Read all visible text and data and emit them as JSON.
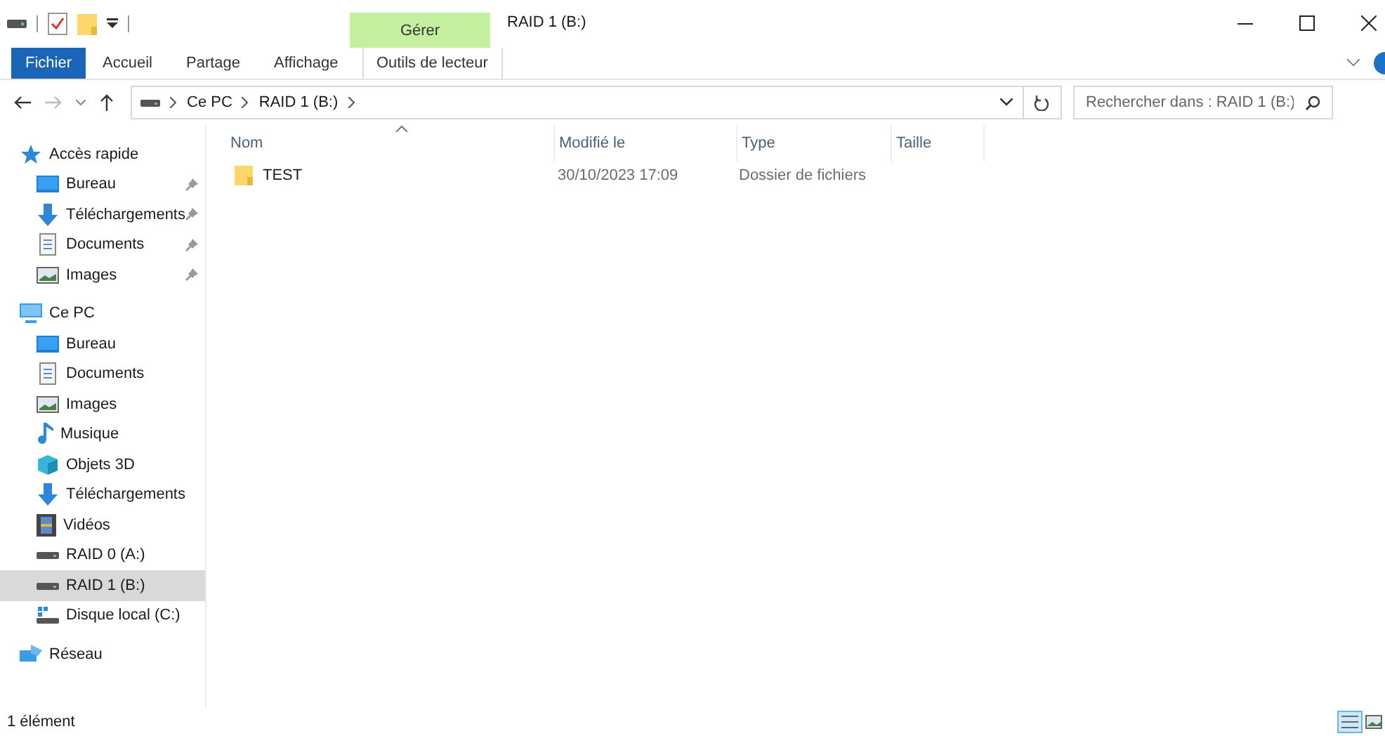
{
  "window": {
    "title": "RAID 1 (B:)",
    "context_tab": "Gérer"
  },
  "ribbon": {
    "tabs": [
      {
        "label": "Fichier",
        "kind": "file",
        "selected": false
      },
      {
        "label": "Accueil",
        "kind": "tab",
        "selected": false
      },
      {
        "label": "Partage",
        "kind": "tab",
        "selected": false
      },
      {
        "label": "Affichage",
        "kind": "tab",
        "selected": false
      },
      {
        "label": "Outils de lecteur",
        "kind": "context",
        "selected": false
      }
    ]
  },
  "address_bar": {
    "path": [
      "Ce PC",
      "RAID 1 (B:)"
    ]
  },
  "search": {
    "placeholder": "Rechercher dans : RAID 1 (B:)"
  },
  "sidebar": {
    "sections": [
      {
        "label": "Accès rapide",
        "kind": "star",
        "selected": false,
        "children": [
          {
            "label": "Bureau",
            "kind": "desktop",
            "pinned": true,
            "selected": false
          },
          {
            "label": "Téléchargements",
            "kind": "download",
            "pinned": true,
            "selected": false
          },
          {
            "label": "Documents",
            "kind": "document",
            "pinned": true,
            "selected": false
          },
          {
            "label": "Images",
            "kind": "image",
            "pinned": true,
            "selected": false
          }
        ]
      },
      {
        "label": "Ce PC",
        "kind": "pc",
        "selected": false,
        "children": [
          {
            "label": "Bureau",
            "kind": "desktop",
            "pinned": false,
            "selected": false
          },
          {
            "label": "Documents",
            "kind": "document",
            "pinned": false,
            "selected": false
          },
          {
            "label": "Images",
            "kind": "image",
            "pinned": false,
            "selected": false
          },
          {
            "label": "Musique",
            "kind": "music",
            "pinned": false,
            "selected": false
          },
          {
            "label": "Objets 3D",
            "kind": "cube",
            "pinned": false,
            "selected": false
          },
          {
            "label": "Téléchargements",
            "kind": "download",
            "pinned": false,
            "selected": false
          },
          {
            "label": "Vidéos",
            "kind": "video",
            "pinned": false,
            "selected": false
          },
          {
            "label": "RAID 0 (A:)",
            "kind": "drive",
            "pinned": false,
            "selected": false
          },
          {
            "label": "RAID 1 (B:)",
            "kind": "drive",
            "pinned": false,
            "selected": true
          },
          {
            "label": "Disque local (C:)",
            "kind": "windrive",
            "pinned": false,
            "selected": false
          }
        ]
      },
      {
        "label": "Réseau",
        "kind": "network",
        "selected": false
      }
    ]
  },
  "table": {
    "columns": [
      "Nom",
      "Modifié le",
      "Type",
      "Taille"
    ],
    "rows": [
      {
        "name": "TEST",
        "modified": "30/10/2023 17:09",
        "type": "Dossier de fichiers",
        "selected": false
      }
    ]
  },
  "status_bar": {
    "text": "1 élément"
  }
}
